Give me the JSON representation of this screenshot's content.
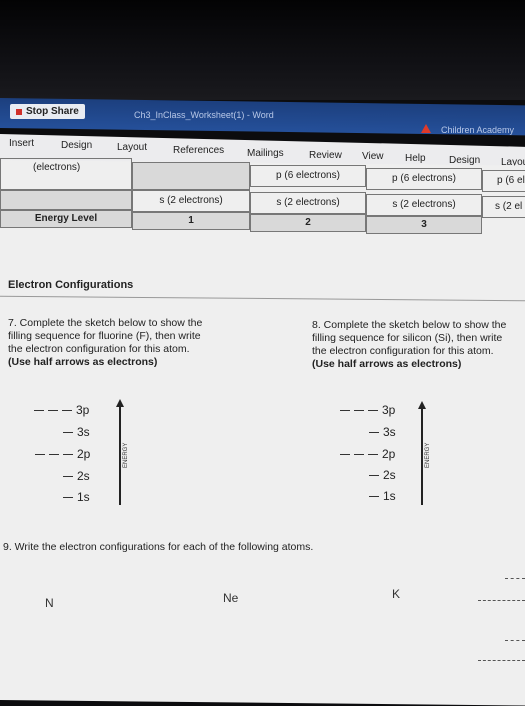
{
  "zoom_bar": {
    "stop_share_label": "Stop Share"
  },
  "window": {
    "title": "Ch3_InClass_Worksheet(1)  -  Word",
    "account_name": "Children Academy"
  },
  "ribbon": {
    "tabs": [
      "Insert",
      "Design",
      "Layout",
      "References",
      "Mailings",
      "Review",
      "View",
      "Help",
      "Design",
      "Layou"
    ]
  },
  "table": {
    "row1": [
      "(electrons)",
      "p (6 electrons)",
      "p (6 electrons)",
      "p (6 el"
    ],
    "row2": [
      "s (2 electrons)",
      "s (2 electrons)",
      "s (2 electrons)",
      "s (2 el"
    ],
    "row3": [
      "Energy Level",
      "1",
      "2",
      "3"
    ]
  },
  "section_title": "Electron Configurations",
  "q7": {
    "lines": [
      "7.  Complete the sketch below to show the",
      "filling sequence for fluorine (F), then write",
      "the electron configuration for this atom."
    ],
    "bold_line": "(Use half arrows as electrons)"
  },
  "q8": {
    "lines": [
      "8.  Complete the sketch below to show the",
      "filling sequence for silicon (Si), then write",
      "the electron configuration for this atom."
    ],
    "bold_line": "(Use half arrows as electrons)"
  },
  "diagram": {
    "orbitals": [
      "3p",
      "3s",
      "2p",
      "2s",
      "1s"
    ],
    "axis_label": "ENERGY"
  },
  "q9": {
    "text": "9.  Write the electron configurations for each of the following atoms."
  },
  "atoms": [
    "N",
    "Ne",
    "K"
  ]
}
